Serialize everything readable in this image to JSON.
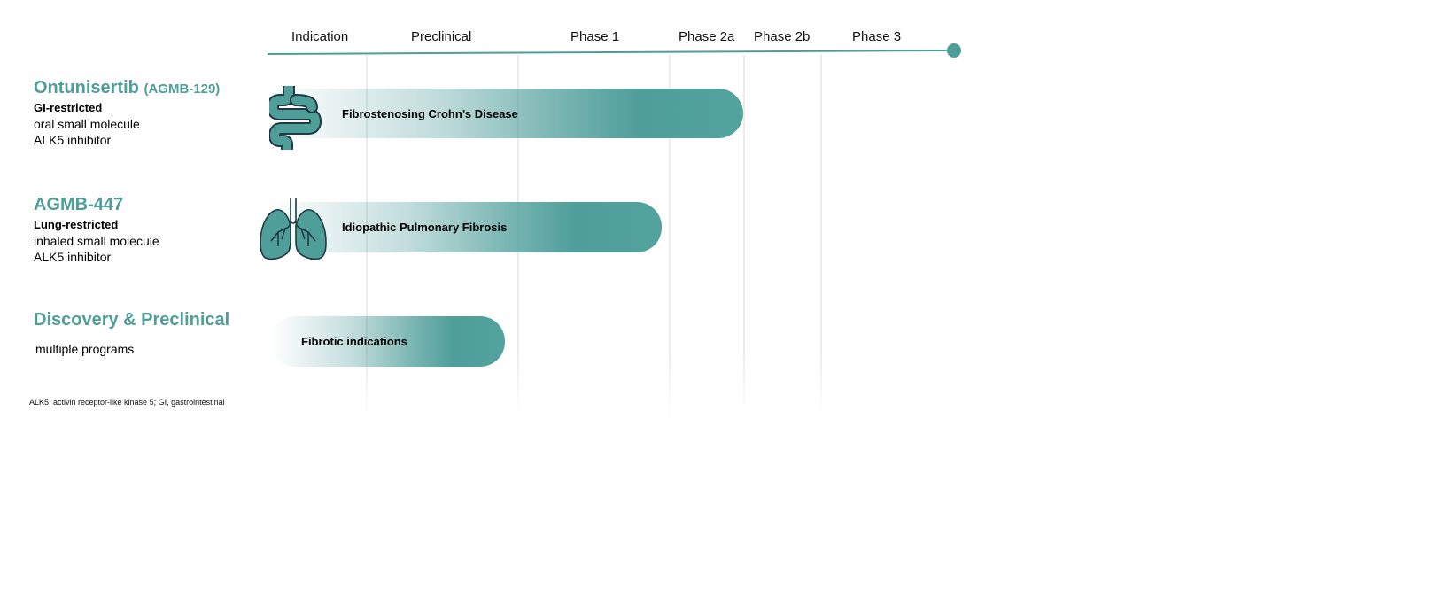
{
  "header": {
    "phases": [
      "Indication",
      "Preclinical",
      "Phase 1",
      "Phase 2a",
      "Phase 2b",
      "Phase 3"
    ]
  },
  "colors": {
    "accent": "#4f9e9a",
    "gridline": "#ececec",
    "icon_fill": "#4f9e9a",
    "icon_stroke": "#1e3a44"
  },
  "programs": [
    {
      "name": "Ontunisertib",
      "code": "(AGMB-129)",
      "lines": [
        "GI-restricted",
        "oral small molecule",
        "ALK5 inhibitor"
      ],
      "indication": "Fibrostenosing Crohn’s Disease",
      "icon": "intestine-icon",
      "stage": "Phase 2a"
    },
    {
      "name": "AGMB-447",
      "code": "",
      "lines": [
        "Lung-restricted",
        "inhaled small molecule",
        "ALK5 inhibitor"
      ],
      "indication": "Idiopathic Pulmonary Fibrosis",
      "icon": "lungs-icon",
      "stage": "Phase 1"
    },
    {
      "name": "Discovery & Preclinical",
      "code": "",
      "lines": [
        "multiple programs"
      ],
      "indication": "Fibrotic indications",
      "icon": "",
      "stage": "Preclinical"
    }
  ],
  "footnote": "ALK5, activin receptor-like kinase 5; GI, gastrointestinal"
}
